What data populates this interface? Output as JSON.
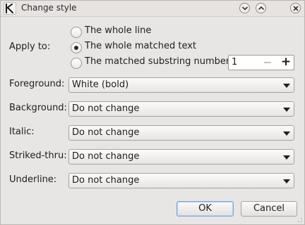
{
  "window": {
    "title": "Change style",
    "app_icon": "kate-app-icon",
    "controls": {
      "minimize_icon": "chevron-down-icon",
      "maximize_icon": "chevron-up-icon",
      "close_icon": "close-icon"
    }
  },
  "apply_to": {
    "label": "Apply to:",
    "options": [
      {
        "label": "The whole line",
        "checked": false
      },
      {
        "label": "The whole matched text",
        "checked": true
      },
      {
        "label": "The matched substring number",
        "checked": false
      }
    ],
    "substring_number": "1",
    "minus_label": "−",
    "plus_label": "+"
  },
  "fields": {
    "foreground": {
      "label": "Foreground:",
      "value": "White (bold)"
    },
    "background": {
      "label": "Background:",
      "value": "Do not change"
    },
    "italic": {
      "label": "Italic:",
      "value": "Do not change"
    },
    "striked": {
      "label": "Striked-thru:",
      "value": "Do not change"
    },
    "underline": {
      "label": "Underline:",
      "value": "Do not change"
    }
  },
  "buttons": {
    "ok": "OK",
    "cancel": "Cancel"
  }
}
